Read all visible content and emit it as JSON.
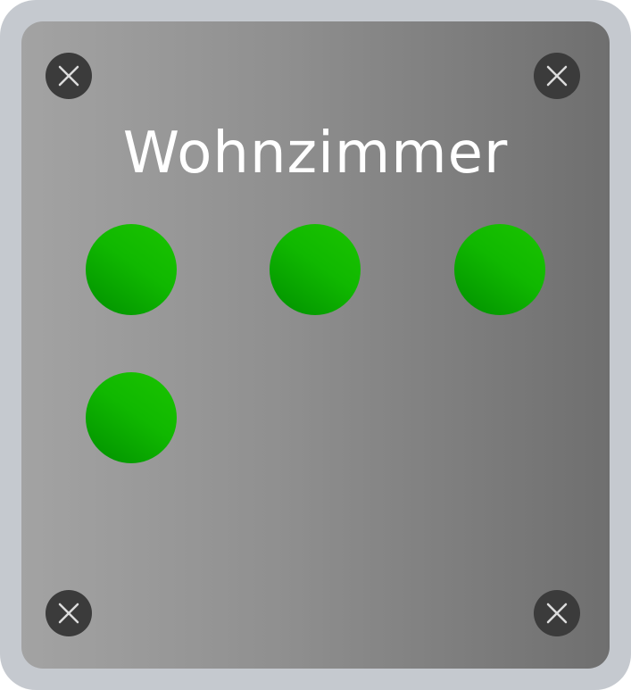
{
  "panel": {
    "title": "Wohnzimmer",
    "screws": [
      "screw-icon",
      "screw-icon",
      "screw-icon",
      "screw-icon"
    ],
    "indicators": [
      {
        "state": "on",
        "color": "#10b800"
      },
      {
        "state": "on",
        "color": "#10b800"
      },
      {
        "state": "on",
        "color": "#10b800"
      },
      {
        "state": "on",
        "color": "#10b800"
      }
    ]
  }
}
